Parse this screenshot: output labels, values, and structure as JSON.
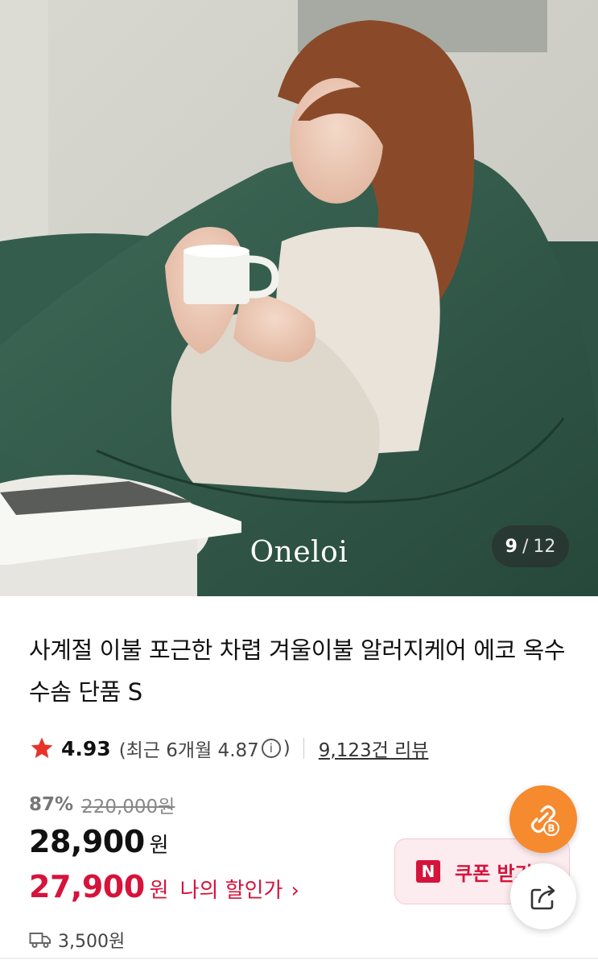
{
  "hero": {
    "brand_logo": "Oneloi",
    "counter": {
      "current": "9",
      "separator": "/",
      "total": "12"
    }
  },
  "product": {
    "title": "사계절 이불 포근한 차렵 겨울이불 알러지케어 에코 옥수수솜 단품 S"
  },
  "rating": {
    "score": "4.93",
    "recent_prefix": "(최근 6개월 4.87",
    "recent_suffix": ")",
    "review_count": "9,123건 리뷰",
    "star_color": "#e8332a"
  },
  "pricing": {
    "discount_rate": "87%",
    "original_price": "220,000원",
    "sale_price": "28,900",
    "sale_currency": "원",
    "my_price": "27,900",
    "my_currency": "원",
    "my_price_label": "나의 할인가",
    "my_price_color": "#d6133b"
  },
  "shipping": {
    "fee": "3,500원"
  },
  "coupon": {
    "logo": "N",
    "label": "쿠폰 받기"
  },
  "floating": {
    "share_link_badge": "B",
    "share_link_color": "#f58a2f"
  },
  "icons": {
    "star": "star-icon",
    "info": "info-icon",
    "truck": "delivery-truck-icon",
    "link": "link-icon",
    "share": "share-icon"
  }
}
